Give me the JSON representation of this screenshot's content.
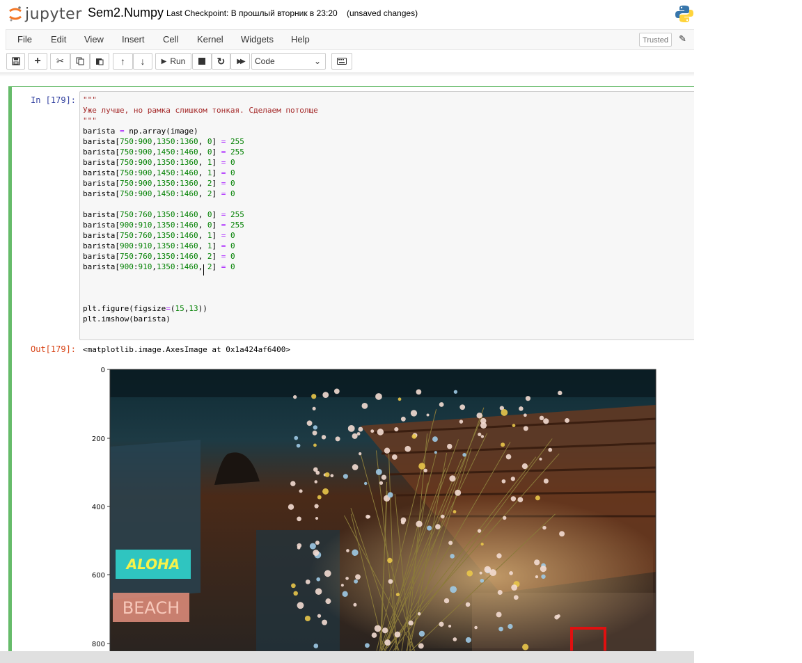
{
  "header": {
    "logo_text": "jupyter",
    "notebook_name": "Sem2.Numpy",
    "checkpoint": "Last Checkpoint: В прошлый вторник в 23:20",
    "unsaved": "(unsaved changes)"
  },
  "menu": {
    "items": [
      "File",
      "Edit",
      "View",
      "Insert",
      "Cell",
      "Kernel",
      "Widgets",
      "Help"
    ],
    "trusted": "Trusted"
  },
  "toolbar": {
    "run_label": "Run",
    "cell_type": "Code"
  },
  "cell": {
    "in_prompt": "In [179]:",
    "out_prompt": "Out[179]:",
    "output_text": "<matplotlib.image.AxesImage at 0x1a424af6400>",
    "code_lines": [
      "\"\"\"",
      "Уже лучше, но рамка слишком тонкая. Сделаем потолще",
      "\"\"\"",
      "barista = np.array(image)",
      "barista[750:900,1350:1360, 0] = 255",
      "barista[750:900,1450:1460, 0] = 255",
      "barista[750:900,1350:1360, 1] = 0",
      "barista[750:900,1450:1460, 1] = 0",
      "barista[750:900,1350:1360, 2] = 0",
      "barista[750:900,1450:1460, 2] = 0",
      "",
      "barista[750:760,1350:1460, 0] = 255",
      "barista[900:910,1350:1460, 0] = 255",
      "barista[750:760,1350:1460, 1] = 0",
      "barista[900:910,1350:1460, 1] = 0",
      "barista[750:760,1350:1460, 2] = 0",
      "barista[900:910,1350:1460, 2] = 0",
      "",
      "",
      "",
      "plt.figure(figsize=(15,13))",
      "plt.imshow(barista)"
    ]
  },
  "plot": {
    "y_ticks": [
      "0",
      "200",
      "400",
      "600",
      "800"
    ],
    "sign_top": "ALOHA",
    "sign_bottom": "BEACH"
  },
  "colors": {
    "cell_border": "#66bb6a",
    "in_prompt": "#303f9f",
    "out_prompt": "#d84315",
    "string": "#a52a2a",
    "number": "#008000",
    "operator": "#aa22ff",
    "frame": "#e01010"
  }
}
